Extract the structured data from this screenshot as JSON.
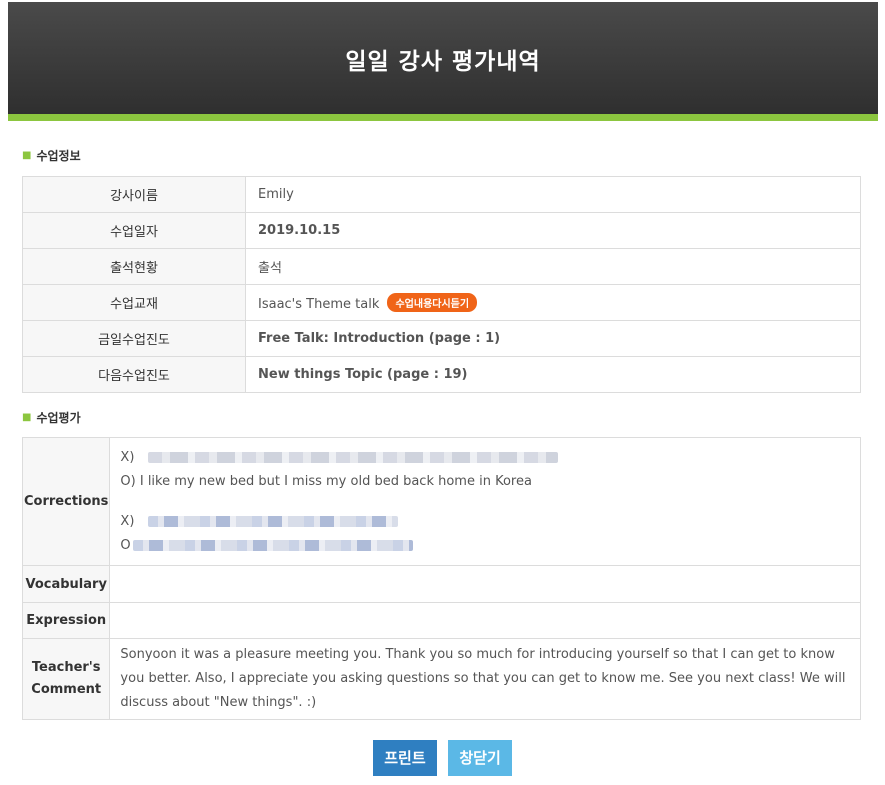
{
  "header": {
    "title": "일일 강사 평가내역"
  },
  "class_info": {
    "section_title": "수업정보",
    "rows": [
      {
        "label": "강사이름",
        "value": "Emily"
      },
      {
        "label": "수업일자",
        "value": "2019.10.15"
      },
      {
        "label": "출석현황",
        "value": "출석"
      },
      {
        "label": "수업교재",
        "value": "Isaac's Theme talk",
        "button": "수업내용다시듣기"
      },
      {
        "label": "금일수업진도",
        "value": "Free Talk: Introduction (page : 1)"
      },
      {
        "label": "다음수업진도",
        "value": "New things Topic (page : 19)"
      }
    ]
  },
  "evaluation": {
    "section_title": "수업평가",
    "corrections_label": "Corrections",
    "corrections": {
      "x1_prefix": "X)",
      "o1": "O) I like my new bed but I miss my old bed back home in Korea",
      "x2_prefix": "X)",
      "o2_prefix": "O"
    },
    "vocabulary_label": "Vocabulary",
    "vocabulary_value": "",
    "expression_label": "Expression",
    "expression_value": "",
    "comment_label_1": "Teacher's",
    "comment_label_2": "Comment",
    "comment": "Sonyoon it was a pleasure meeting you. Thank you so much for introducing yourself so that I can get to know you better. Also, I appreciate you asking questions so that you can get to know me. See you next class! We will discuss about \"New things\". :)"
  },
  "buttons": {
    "print": "프린트",
    "close": "창닫기"
  },
  "colors": {
    "header_bg": "#3a3a3a",
    "accent_green": "#8cc63f",
    "progress_green": "#5a8f1c",
    "next_orange": "#f07b1a",
    "relisten_orange": "#f06418",
    "print_blue": "#2f7fc1",
    "close_blue": "#5bb8e6"
  }
}
